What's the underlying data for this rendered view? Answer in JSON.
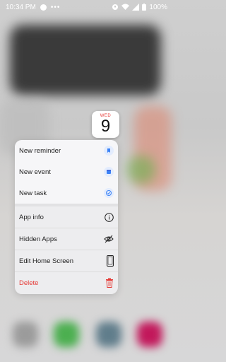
{
  "status_bar": {
    "time": "10:34 PM",
    "battery": "100%"
  },
  "app_icon": {
    "day": "WED",
    "date": "9"
  },
  "menu": {
    "shortcuts": [
      {
        "label": "New reminder",
        "icon": "reminder-icon"
      },
      {
        "label": "New event",
        "icon": "calendar-event-icon"
      },
      {
        "label": "New task",
        "icon": "task-check-icon"
      }
    ],
    "actions": [
      {
        "label": "App info",
        "icon": "info-icon"
      },
      {
        "label": "Hidden Apps",
        "icon": "eye-off-icon"
      },
      {
        "label": "Edit Home Screen",
        "icon": "phone-icon"
      },
      {
        "label": "Delete",
        "icon": "trash-icon"
      }
    ]
  },
  "colors": {
    "accent_blue": "#3b82f6",
    "delete_red": "#e53935"
  }
}
